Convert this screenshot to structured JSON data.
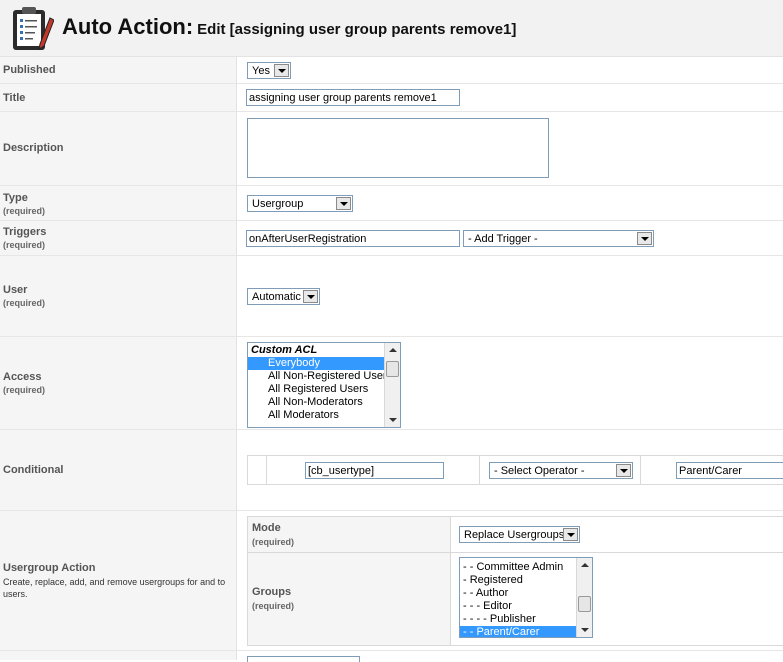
{
  "header": {
    "title": "Auto Action:",
    "subtitle": "Edit [assigning user group parents remove1]",
    "icon": "clipboard-pencil-icon"
  },
  "published": {
    "label": "Published",
    "value": "Yes"
  },
  "title": {
    "label": "Title",
    "value": "assigning user group parents remove1"
  },
  "description": {
    "label": "Description",
    "value": ""
  },
  "type": {
    "label": "Type",
    "required": "(required)",
    "value": "Usergroup"
  },
  "triggers": {
    "label": "Triggers",
    "required": "(required)",
    "value": "onAfterUserRegistration",
    "add_trigger": "- Add Trigger -"
  },
  "user": {
    "label": "User",
    "required": "(required)",
    "value": "Automatic"
  },
  "access": {
    "label": "Access",
    "required": "(required)",
    "group_header": "Custom ACL",
    "options": [
      "Everybody",
      "All Non-Registered Users",
      "All Registered Users",
      "All Non-Moderators",
      "All Moderators"
    ]
  },
  "conditional": {
    "label": "Conditional",
    "field": "[cb_usertype]",
    "operator": "- Select Operator -",
    "value": "Parent/Carer"
  },
  "usergroup_action": {
    "label": "Usergroup Action",
    "description": "Create, replace, add, and remove usergroups for and to users.",
    "mode_label": "Mode",
    "mode_required": "(required)",
    "mode_value": "Replace Usergroups",
    "groups_label": "Groups",
    "groups_required": "(required)",
    "groups": [
      "- - Committee Admin",
      "- Registered",
      "- - Author",
      "- - - Editor",
      "- - - - Publisher",
      "- - Parent/Carer"
    ]
  }
}
